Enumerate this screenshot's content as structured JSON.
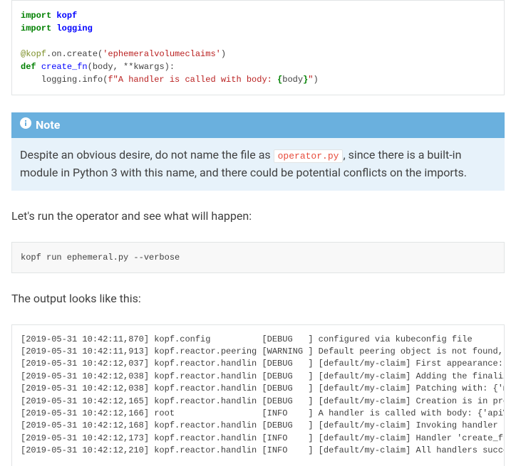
{
  "code": {
    "l1_import": "import",
    "l1_mod": "kopf",
    "l2_import": "import",
    "l2_mod": "logging",
    "l3_dec_at": "@kopf",
    "l3_dec_rest": ".on.create(",
    "l3_dec_str": "'ephemeralvolumeclaims'",
    "l3_dec_close": ")",
    "l4_def": "def",
    "l4_fn": "create_fn",
    "l4_sig": "(body, **kwargs):",
    "l5_indent": "    logging.info(",
    "l5_fprefix": "f\"A handler is called with body: ",
    "l5_open": "{",
    "l5_var": "body",
    "l5_close": "}",
    "l5_end": "\"",
    "l5_paren": ")"
  },
  "note": {
    "title": "Note",
    "body_pre": "Despite an obvious desire, do not name the file as ",
    "body_code": "operator.py",
    "body_post": ", since there is a built-in module in Python 3 with this name, and there could be potential conflicts on the imports."
  },
  "para1": "Let's run the operator and see what will happen:",
  "cmd": "kopf run ephemeral.py --verbose",
  "para2": "The output looks like this:",
  "log": [
    "[2019-05-31 10:42:11,870] kopf.config          [DEBUG   ] configured via kubeconfig file",
    "[2019-05-31 10:42:11,913] kopf.reactor.peering [WARNING ] Default peering object is not found, falling b",
    "[2019-05-31 10:42:12,037] kopf.reactor.handlin [DEBUG   ] [default/my-claim] First appearance: {'apiVers",
    "[2019-05-31 10:42:12,038] kopf.reactor.handlin [DEBUG   ] [default/my-claim] Adding the finalizer, thus ",
    "[2019-05-31 10:42:12,038] kopf.reactor.handlin [DEBUG   ] [default/my-claim] Patching with: {'metadata'",
    "[2019-05-31 10:42:12,165] kopf.reactor.handlin [DEBUG   ] [default/my-claim] Creation is in progress: {",
    "[2019-05-31 10:42:12,166] root                 [INFO    ] A handler is called with body: {'apiVersion':",
    "[2019-05-31 10:42:12,168] kopf.reactor.handlin [DEBUG   ] [default/my-claim] Invoking handler 'create_fn",
    "[2019-05-31 10:42:12,173] kopf.reactor.handlin [INFO    ] [default/my-claim] Handler 'create_fn' succee",
    "[2019-05-31 10:42:12,210] kopf.reactor.handlin [INFO    ] [default/my-claim] All handlers succeeded for"
  ]
}
